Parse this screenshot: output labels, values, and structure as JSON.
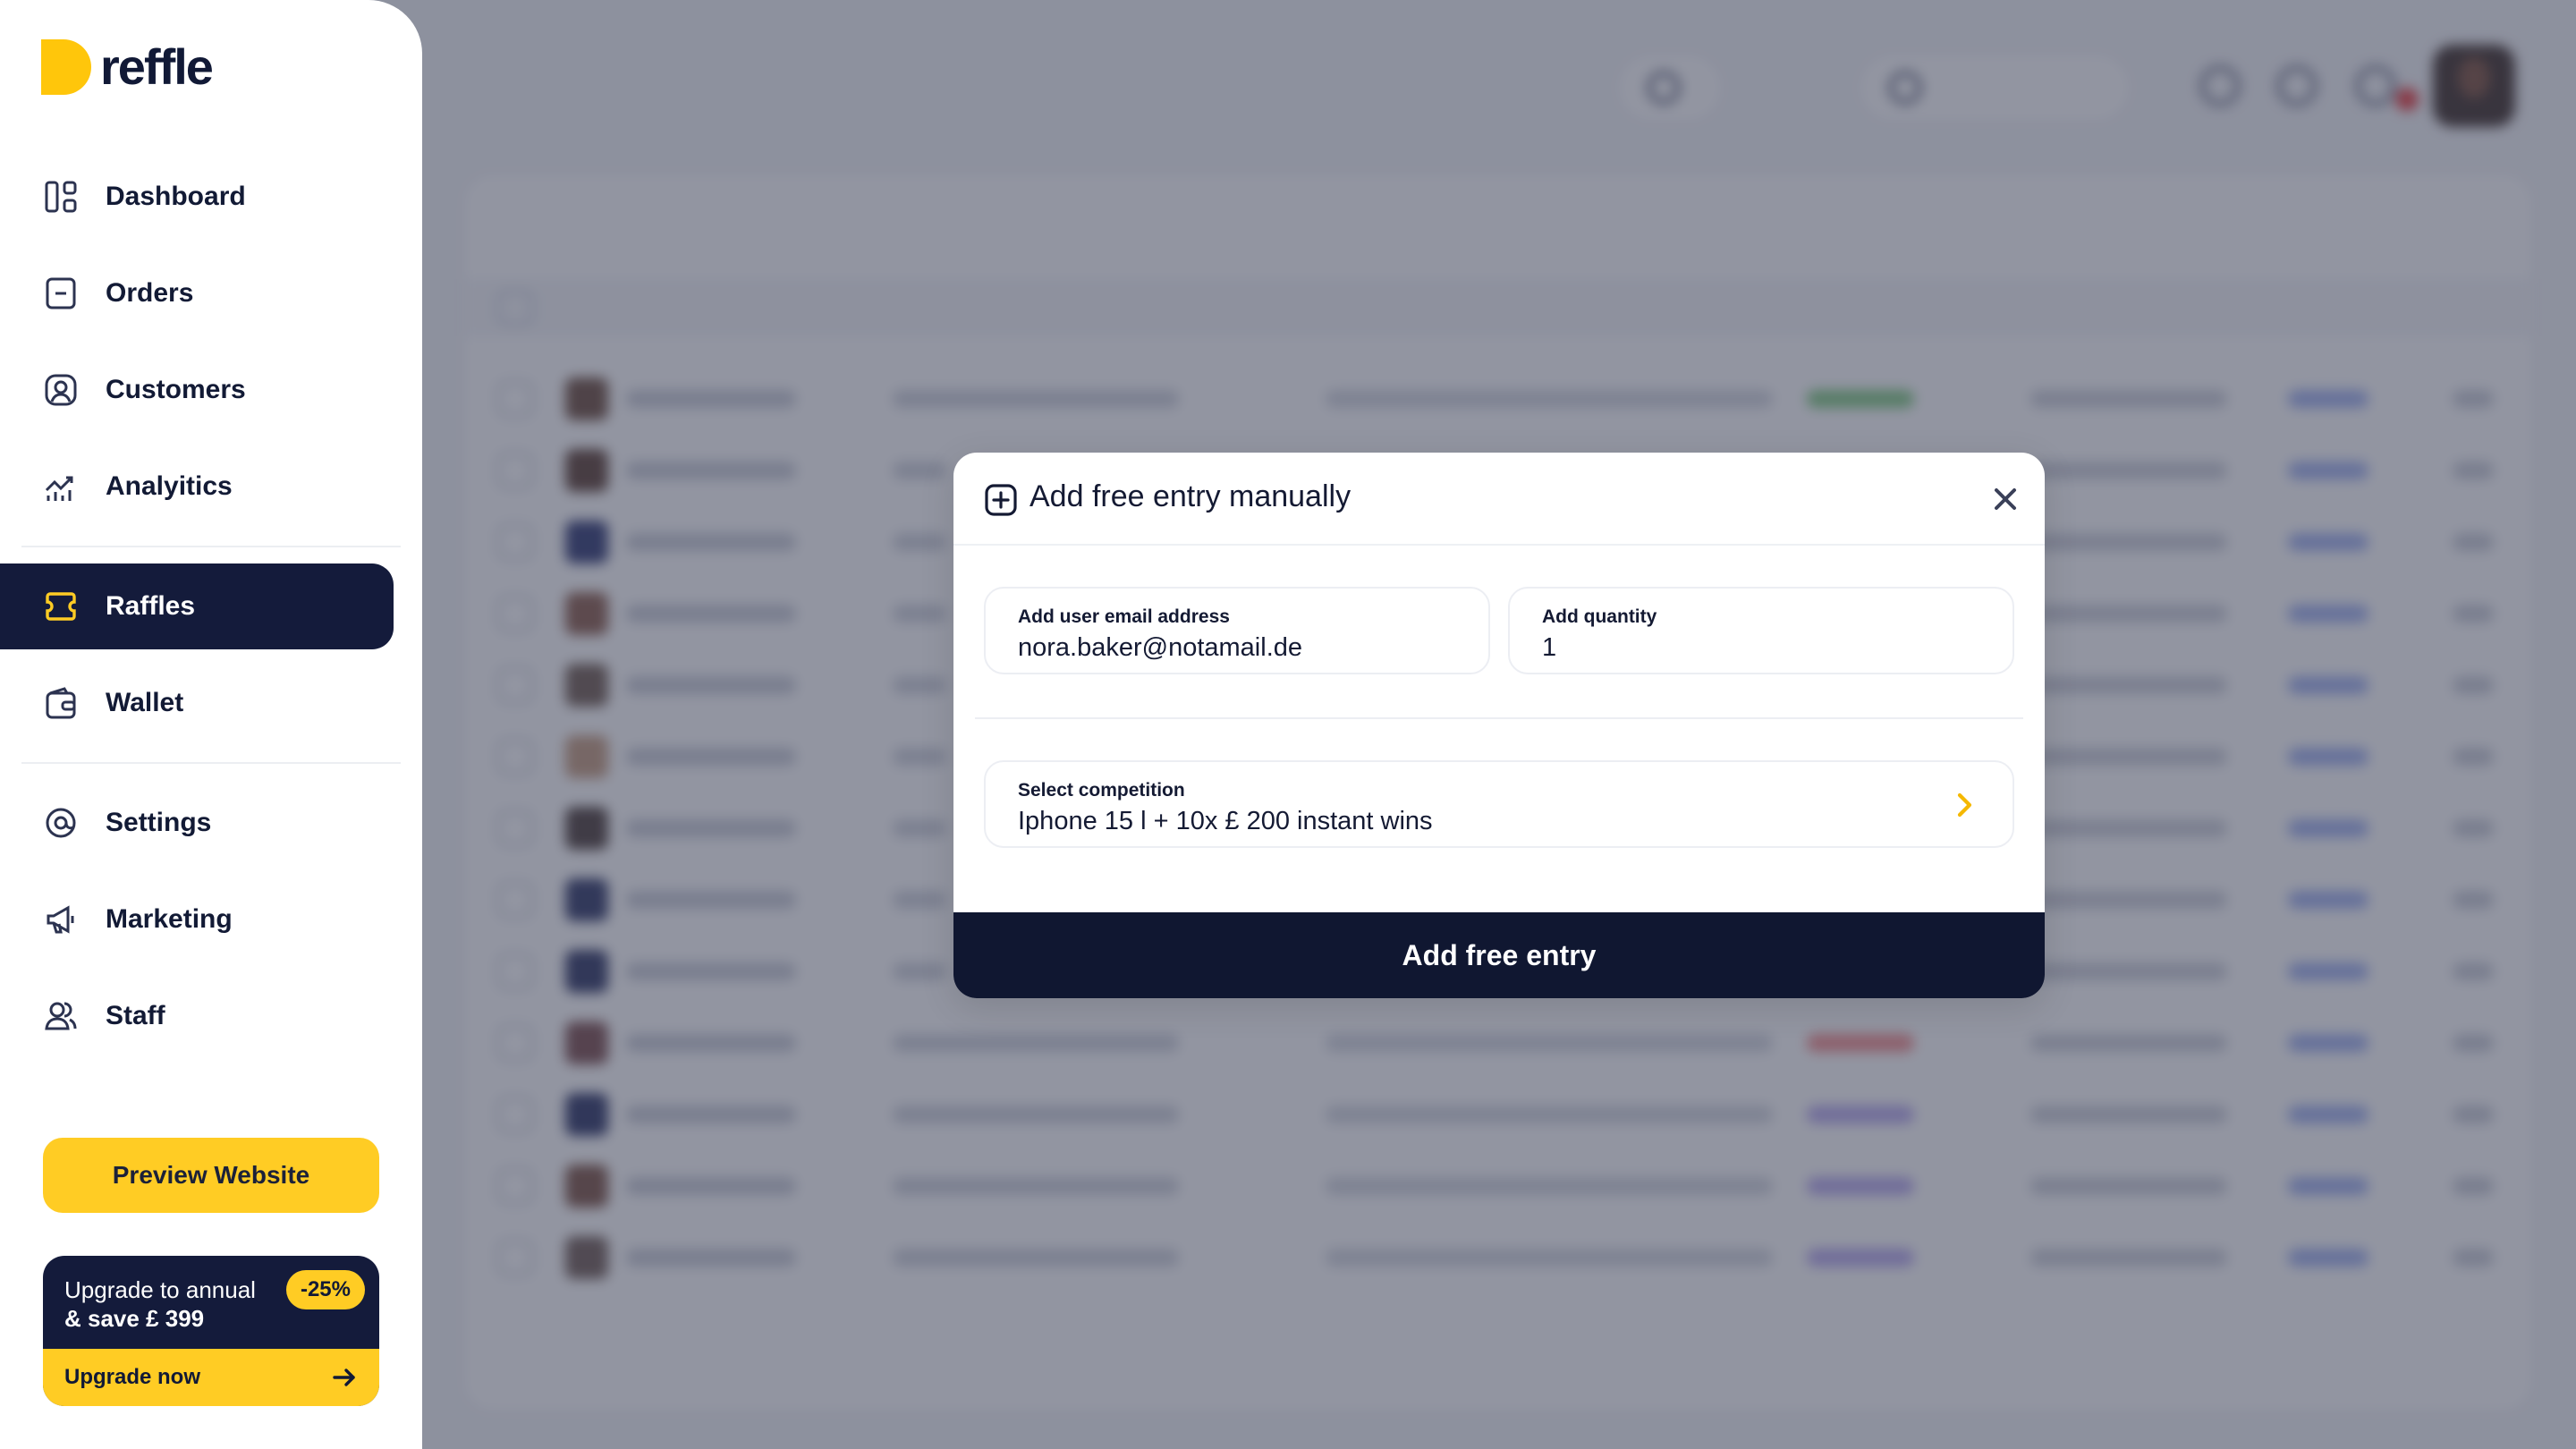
{
  "brand": {
    "name": "reffle"
  },
  "sidebar": {
    "items": [
      {
        "label": "Dashboard",
        "icon": "dashboard-icon"
      },
      {
        "label": "Orders",
        "icon": "orders-icon"
      },
      {
        "label": "Customers",
        "icon": "customers-icon"
      },
      {
        "label": "Analyitics",
        "icon": "analytics-icon"
      },
      {
        "label": "Raffles",
        "icon": "ticket-icon",
        "active": true
      },
      {
        "label": "Wallet",
        "icon": "wallet-icon"
      },
      {
        "label": "Settings",
        "icon": "settings-icon"
      },
      {
        "label": "Marketing",
        "icon": "megaphone-icon"
      },
      {
        "label": "Staff",
        "icon": "staff-icon"
      }
    ],
    "preview_button": "Preview Website",
    "upgrade": {
      "line1": "Upgrade to annual",
      "line2": "& save £ 399",
      "badge": "-25%",
      "cta": "Upgrade now"
    }
  },
  "modal": {
    "title": "Add free entry manually",
    "email_label": "Add user email address",
    "email_value": "nora.baker@notamail.de",
    "quantity_label": "Add quantity",
    "quantity_value": "1",
    "competition_label": "Select competition",
    "competition_value": "Iphone 15 l + 10x £ 200 instant wins",
    "submit_label": "Add free entry"
  },
  "colors": {
    "brand_yellow": "#ffcc24",
    "navy": "#141b3b",
    "accent_chevron": "#f5b800"
  }
}
